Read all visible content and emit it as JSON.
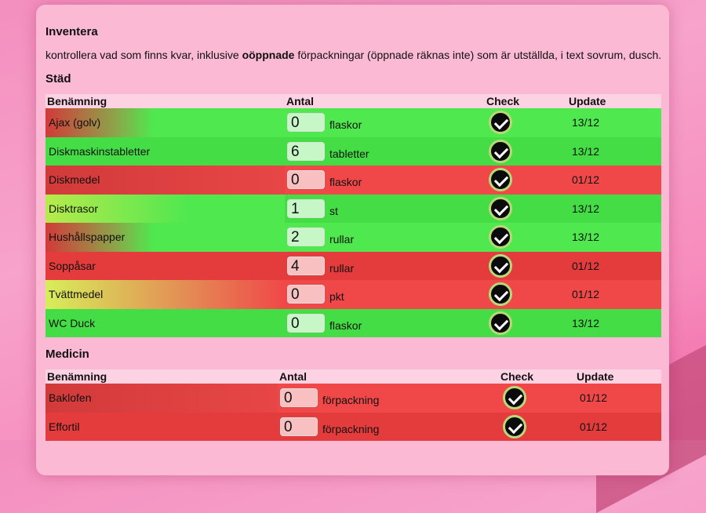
{
  "title": "Inventera",
  "description": {
    "pre": "kontrollera vad som finns kvar, inklusive ",
    "bold": "oöppnade",
    "post": " förpackningar (öppnade räknas inte) som är utställda, i text sovrum, dusch."
  },
  "sections": [
    {
      "title": "Städ",
      "headers": {
        "name": "Benämning",
        "qty": "Antal",
        "check": "Check",
        "update": "Update"
      },
      "rows": [
        {
          "name": "Ajax (golv)",
          "qty": "0",
          "unit": "flaskor",
          "update": "13/12",
          "status": "green"
        },
        {
          "name": "Diskmaskinstabletter",
          "qty": "6",
          "unit": "tabletter",
          "update": "13/12",
          "status": "green"
        },
        {
          "name": "Diskmedel",
          "qty": "0",
          "unit": "flaskor",
          "update": "01/12",
          "status": "red"
        },
        {
          "name": "Disktrasor",
          "qty": "1",
          "unit": "st",
          "update": "13/12",
          "status": "green"
        },
        {
          "name": "Hushållspapper",
          "qty": "2",
          "unit": "rullar",
          "update": "13/12",
          "status": "green"
        },
        {
          "name": "Soppåsar",
          "qty": "4",
          "unit": "rullar",
          "update": "01/12",
          "status": "red"
        },
        {
          "name": "Tvättmedel",
          "qty": "0",
          "unit": "pkt",
          "update": "01/12",
          "status": "red"
        },
        {
          "name": "WC Duck",
          "qty": "0",
          "unit": "flaskor",
          "update": "13/12",
          "status": "green"
        }
      ]
    },
    {
      "title": "Medicin",
      "headers": {
        "name": "Benämning",
        "qty": "Antal",
        "check": "Check",
        "update": "Update"
      },
      "rows": [
        {
          "name": "Baklofen",
          "qty": "0",
          "unit": "förpackning",
          "update": "01/12",
          "status": "red"
        },
        {
          "name": "Effortil",
          "qty": "0",
          "unit": "förpackning",
          "update": "01/12",
          "status": "red"
        }
      ]
    }
  ],
  "colors": {
    "green": "#4fe84f",
    "red": "#f04848",
    "card": "#fbb9d3"
  },
  "icons": {
    "check": "check-circle-icon"
  }
}
